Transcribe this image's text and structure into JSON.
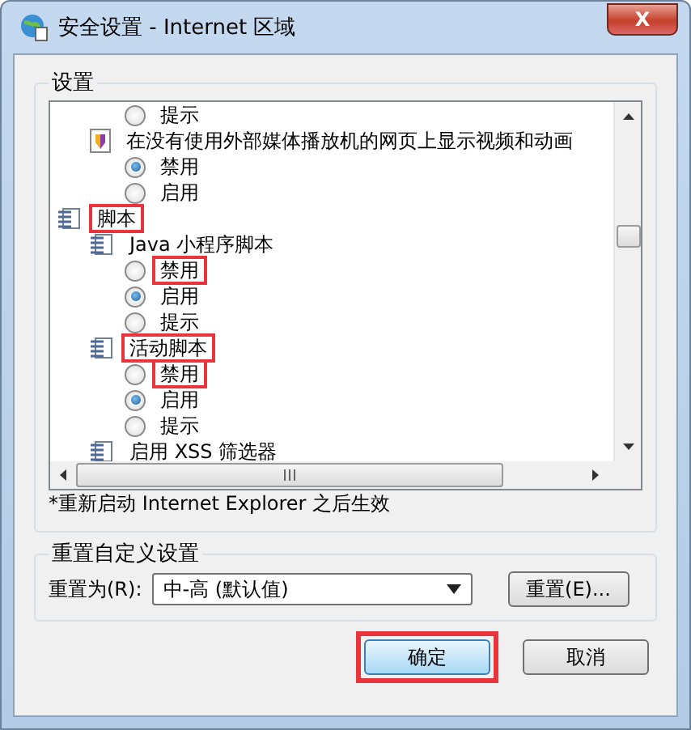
{
  "window": {
    "title": "安全设置 - Internet 区域",
    "close": "X"
  },
  "settings_group": {
    "title": "设置",
    "tree": [
      {
        "kind": "option",
        "label": "提示",
        "selected": false,
        "highlighted": false
      },
      {
        "kind": "media",
        "label": "在没有使用外部媒体播放机的网页上显示视频和动画",
        "highlighted": false,
        "children": [
          {
            "kind": "option",
            "label": "禁用",
            "selected": true,
            "highlighted": false
          },
          {
            "kind": "option",
            "label": "启用",
            "selected": false,
            "highlighted": false
          }
        ]
      },
      {
        "kind": "category",
        "label": "脚本",
        "highlighted": true,
        "children": [
          {
            "kind": "setting",
            "label": "Java 小程序脚本",
            "highlighted": false,
            "children": [
              {
                "kind": "option",
                "label": "禁用",
                "selected": false,
                "highlighted": true
              },
              {
                "kind": "option",
                "label": "启用",
                "selected": true,
                "highlighted": false
              },
              {
                "kind": "option",
                "label": "提示",
                "selected": false,
                "highlighted": false
              }
            ]
          },
          {
            "kind": "setting",
            "label": "活动脚本",
            "highlighted": true,
            "children": [
              {
                "kind": "option",
                "label": "禁用",
                "selected": false,
                "highlighted": true
              },
              {
                "kind": "option",
                "label": "启用",
                "selected": true,
                "highlighted": false
              },
              {
                "kind": "option",
                "label": "提示",
                "selected": false,
                "highlighted": false
              }
            ]
          },
          {
            "kind": "setting",
            "label": "启用 XSS 筛选器",
            "highlighted": false
          }
        ]
      }
    ],
    "note": "*重新启动 Internet Explorer 之后生效"
  },
  "reset_group": {
    "title": "重置自定义设置",
    "label": "重置为(R):",
    "value": "中-高 (默认值)",
    "button": "重置(E)..."
  },
  "buttons": [
    {
      "label": "确定",
      "default": true,
      "highlighted": true
    },
    {
      "label": "取消",
      "default": false,
      "highlighted": false
    }
  ]
}
